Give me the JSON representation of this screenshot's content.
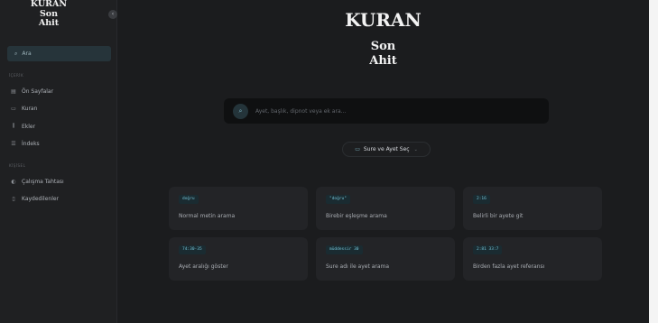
{
  "sidebar": {
    "brand": [
      "KURAN",
      "Son",
      "Ahit"
    ],
    "collapse_icon": "chevron-left-icon",
    "search_label": "Ara",
    "sections": [
      {
        "label": "İÇERİK",
        "items": [
          {
            "label": "Ön Sayfalar",
            "icon": "document-icon"
          },
          {
            "label": "Kuran",
            "icon": "book-icon"
          },
          {
            "label": "Ekler",
            "icon": "library-icon"
          },
          {
            "label": "İndeks",
            "icon": "list-icon"
          }
        ]
      },
      {
        "label": "KİŞİSEL",
        "items": [
          {
            "label": "Çalışma Tahtası",
            "icon": "palette-icon"
          },
          {
            "label": "Kaydedilenler",
            "icon": "bookmark-icon"
          }
        ]
      }
    ]
  },
  "main": {
    "title": "KURAN",
    "subtitle": [
      "Son",
      "Ahit"
    ],
    "search_placeholder": "Ayet, başlık, dipnot veya ek ara...",
    "select_label": "Sure ve Ayet Seç",
    "cards": [
      {
        "badge": "doğru",
        "desc": "Normal metin arama"
      },
      {
        "badge": "\"doğru\"",
        "desc": "Birebir eşleşme arama"
      },
      {
        "badge": "2:16",
        "desc": "Belirli bir ayete git"
      },
      {
        "badge": "74:30-35",
        "desc": "Ayet aralığı göster"
      },
      {
        "badge": "müddessir 30",
        "desc": "Sure adı ile ayet arama"
      },
      {
        "badge": "2:81 33:7",
        "desc": "Birden fazla ayet referansı"
      }
    ]
  },
  "colors": {
    "background": "#1b1c1e",
    "sidebar": "#1f2022",
    "accent": "#74c1d4",
    "card": "#232427"
  }
}
